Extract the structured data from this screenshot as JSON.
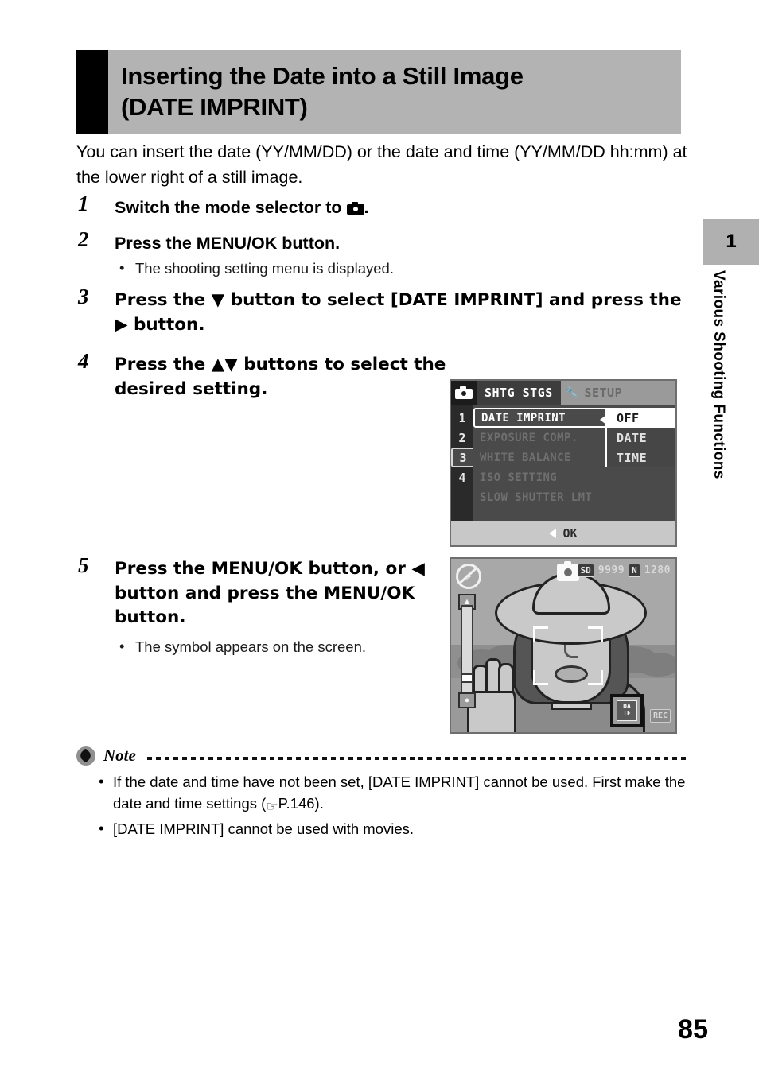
{
  "heading": {
    "title_line1": "Inserting the Date into a Still Image",
    "title_line2": "(DATE IMPRINT)"
  },
  "intro": "You can insert the date (YY/MM/DD) or the date and time (YY/MM/DD hh:mm) at the lower right of a still image.",
  "steps": [
    {
      "number": "1",
      "title_before": "Switch the mode selector to",
      "title_after": ".",
      "icon": "camera-icon",
      "bullets": []
    },
    {
      "number": "2",
      "title_before": "Press the MENU/OK button.",
      "title_after": "",
      "icon": "",
      "bullets": [
        "The shooting setting menu is displayed."
      ]
    },
    {
      "number": "3",
      "title_before": "Press the ▼ button to select [DATE IMPRINT] and press the ▶ button.",
      "title_after": "",
      "icon": "",
      "bullets": []
    },
    {
      "number": "4",
      "title_before": "Press the ▲▼ buttons to select the desired setting.",
      "title_after": "",
      "icon": "",
      "bullets": []
    },
    {
      "number": "5",
      "title_before": "Press the MENU/OK button, or ◀ button and press the MENU/OK button.",
      "title_after": "",
      "icon": "",
      "bullets": [
        "The symbol appears on the screen."
      ]
    }
  ],
  "menu_screen": {
    "tab_active": "SHTG STGS",
    "tab_inactive": "SETUP",
    "numbers": [
      "1",
      "2",
      "3",
      "4"
    ],
    "active_number": "3",
    "items": [
      "DATE IMPRINT",
      "EXPOSURE COMP.",
      "WHITE BALANCE",
      "ISO SETTING",
      "SLOW SHUTTER LMT"
    ],
    "selected_item": "DATE IMPRINT",
    "dropdown_options": [
      "OFF",
      "DATE",
      "TIME"
    ],
    "dropdown_selected": "OFF",
    "footer_label": "OK"
  },
  "photo_screen": {
    "card_chip": "SD",
    "shots_remaining": "9999",
    "quality_chip": "N",
    "image_size": "1280",
    "date_badge_top": "DA",
    "date_badge_bottom": "TE",
    "rec_chip": "REC",
    "zoom_tele_icon": "tele-icon",
    "zoom_wide_icon": "wide-icon",
    "flash_icon": "flash-off-icon",
    "mode_icon": "camera-mode-icon"
  },
  "note": {
    "label": "Note",
    "items_prefix": [
      "If the date and time have not been set, [DATE IMPRINT] cannot be used. First make the date and time settings (",
      "[DATE IMPRINT] cannot be used with movies."
    ],
    "page_ref": "P.146",
    "items_suffix": [
      ").",
      ""
    ]
  },
  "chapter": {
    "number": "1",
    "label": "Various Shooting Functions"
  },
  "page_number": "85",
  "colors": {
    "heading_bar": "#b3b3b3",
    "heading_block": "#000000",
    "chapter_tab": "#b0b0b0"
  }
}
